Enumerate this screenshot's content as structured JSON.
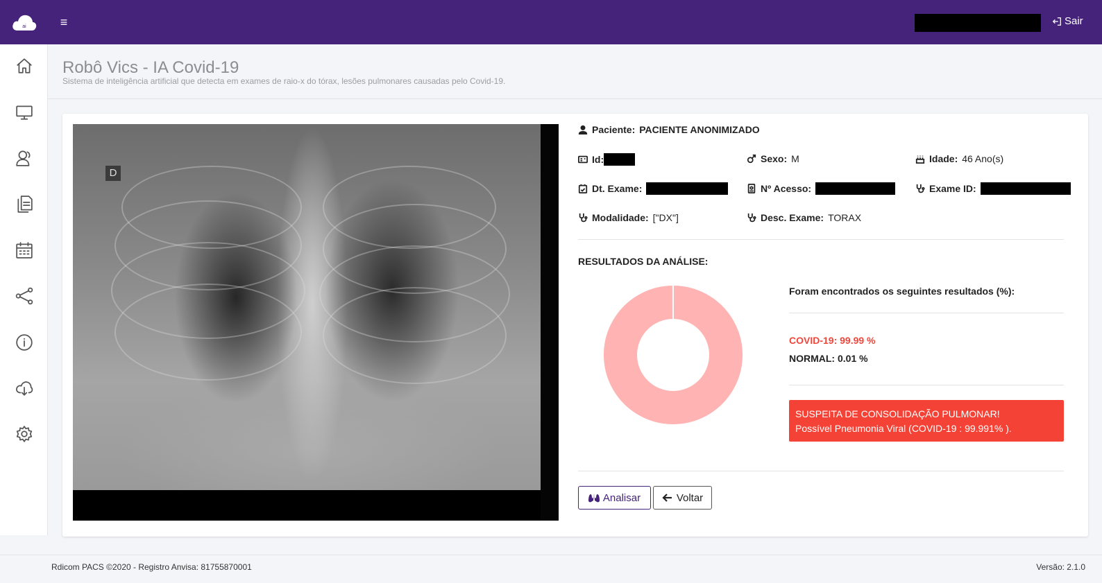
{
  "topbar": {
    "logout_label": "Sair",
    "brand_color": "#45237a"
  },
  "sidebar": {
    "items": [
      {
        "icon": "home-icon"
      },
      {
        "icon": "monitor-icon"
      },
      {
        "icon": "users-icon"
      },
      {
        "icon": "files-icon"
      },
      {
        "icon": "calendar-icon"
      },
      {
        "icon": "share-icon"
      },
      {
        "icon": "info-icon"
      },
      {
        "icon": "cloud-download-icon"
      },
      {
        "icon": "gear-icon"
      }
    ]
  },
  "header": {
    "title": "Robô Vics - IA Covid-19",
    "subtitle": "Sistema de inteligência artificial que detecta em exames de raio-x do tórax, lesões pulmonares causadas pelo Covid-19."
  },
  "xray": {
    "marker": "D"
  },
  "patient": {
    "label": "Paciente:",
    "name": "PACIENTE ANONIMIZADO",
    "id_label": "Id:",
    "sexo_label": "Sexo:",
    "sexo": "M",
    "idade_label": "Idade:",
    "idade": "46 Ano(s)",
    "dt_exame_label": "Dt. Exame:",
    "acesso_label": "Nº Acesso:",
    "exame_id_label": "Exame ID:",
    "modalidade_label": "Modalidade:",
    "modalidade": "[\"DX\"]",
    "desc_label": "Desc. Exame:",
    "desc": "TORAX"
  },
  "results": {
    "title": "RESULTADOS DA ANÁLISE:",
    "found_title": "Foram encontrados os seguintes resultados (%):",
    "covid": "COVID-19: 99.99 %",
    "normal": "NORMAL: 0.01 %",
    "alert_line1": "SUSPEITA DE CONSOLIDAÇÃO PULMONAR!",
    "alert_line2": "Possível Pneumonia Viral (COVID-19 : 99.991% ).",
    "covid_color": "#f0463a",
    "alert_color": "#f44336"
  },
  "chart_data": {
    "type": "pie",
    "categories": [
      "COVID-19",
      "NORMAL"
    ],
    "values": [
      99.99,
      0.01
    ],
    "colors": [
      "#ffb3b3",
      "#ffffff"
    ]
  },
  "actions": {
    "analisar": "Analisar",
    "voltar": "Voltar"
  },
  "footer": {
    "left": "Rdicom PACS ©2020 - Registro Anvisa: 81755870001",
    "right": "Versão: 2.1.0"
  }
}
